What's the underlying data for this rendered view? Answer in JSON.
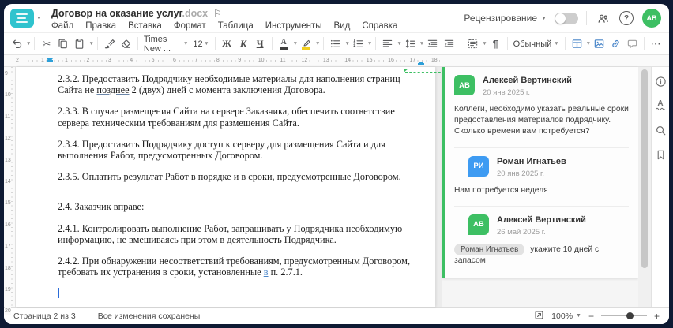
{
  "window": {
    "title": "Договор на оказание услуг",
    "extension": ".docx"
  },
  "header": {
    "menu": [
      "Файл",
      "Правка",
      "Вставка",
      "Формат",
      "Таблица",
      "Инструменты",
      "Вид",
      "Справка"
    ],
    "review_label": "Рецензирование",
    "avatar_initials": "АВ"
  },
  "toolbar": {
    "font_name": "Times New ...",
    "font_size": "12",
    "bold": "Ж",
    "italic": "К",
    "underline": "Ч",
    "font_color_letter": "А",
    "style_name": "Обычный",
    "pilcrow": "¶",
    "more": "⋯"
  },
  "icons": {
    "flag": "⚐",
    "scissors": "✂",
    "question": "?",
    "info": "i",
    "spell_letter": "А",
    "caret": "▾",
    "minus": "−",
    "plus": "+"
  },
  "rulers": {
    "horizontal": [
      "2",
      "1",
      "1",
      "2",
      "3",
      "4",
      "5",
      "6",
      "7",
      "8",
      "9",
      "10",
      "11",
      "12",
      "13",
      "14",
      "15",
      "16",
      "17",
      "18"
    ],
    "vertical": [
      "9",
      "10",
      "11",
      "12",
      "13",
      "14",
      "15",
      "16",
      "17",
      "18",
      "19",
      "20"
    ]
  },
  "document": {
    "p1": {
      "before": "2.3.2. Предоставить Подрядчику необходимые материалы для наполнения страниц Сайта не ",
      "commented": "позднее",
      "after": " 2 (двух) дней с момента заключения Договора."
    },
    "p2": "2.3.3. В случае размещения Сайта на сервере Заказчика, обеспечить соответствие сервера техническим требованиям для размещения Сайта.",
    "p3": "2.3.4. Предоставить Подрядчику доступ к серверу для размещения Сайта и для выполнения Работ, предусмотренных Договором.",
    "p4": "2.3.5. Оплатить результат Работ в порядке и в сроки, предусмотренные Договором.",
    "p5": "2.4. Заказчик вправе:",
    "p6": "2.4.1. Контролировать выполнение Работ, запрашивать у Подрядчика необходимую информацию, не вмешиваясь при этом в деятельность Подрядчика.",
    "p7": {
      "before": "2.4.2. При обнаружении несоответствий требованиям, предусмотренным Договором, требовать их устранения в сроки, установленные ",
      "ref": "в",
      "after": " п. 2.7.1."
    }
  },
  "comments": {
    "thread": [
      {
        "initials": "АВ",
        "name": "Алексей Вертинский",
        "date": "20 янв 2025 г.",
        "text": "Коллеги, необходимо указать реальные сроки предоставления материалов подрядчику. Сколько времени вам потребуется?"
      },
      {
        "initials": "РИ",
        "name": "Роман Игнатьев",
        "date": "20 янв 2025 г.",
        "text": "Нам потребуется неделя"
      },
      {
        "initials": "АВ",
        "name": "Алексей Вертинский",
        "date": "26 май 2025 г.",
        "mention": "Роман Игнатьев",
        "text": " укажите 10 дней с запасом"
      }
    ]
  },
  "statusbar": {
    "page_info": "Страница 2 из 3",
    "saved_info": "Все изменения сохранены",
    "zoom_value": "100%"
  },
  "colors": {
    "brand_teal": "#2fc3ce",
    "accent_green": "#3dbf63",
    "accent_blue": "#3e9bf2",
    "toolbar_blue": "#4a86c9",
    "ruler_marker_blue": "#2d9fd8",
    "highlight_yellow": "#f2cf1d"
  }
}
